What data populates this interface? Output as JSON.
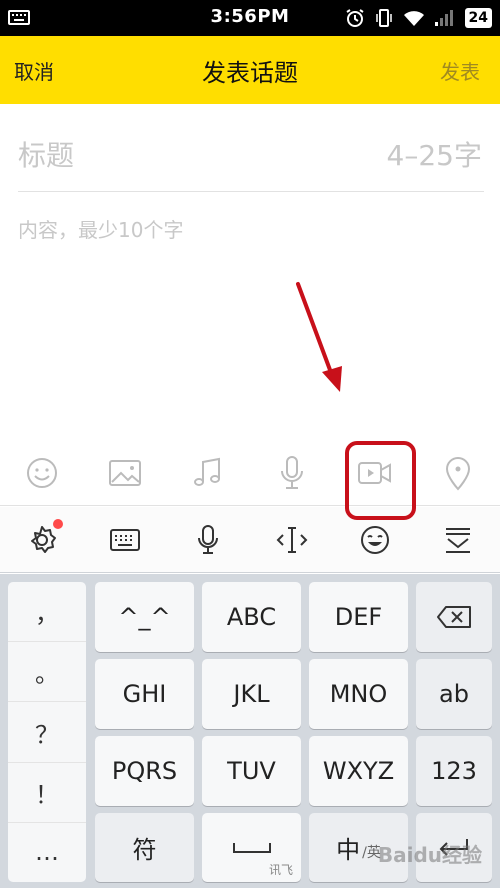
{
  "status_bar": {
    "time": "3:56PM",
    "battery": "24"
  },
  "header": {
    "cancel": "取消",
    "title": "发表话题",
    "publish": "发表"
  },
  "editor": {
    "title_placeholder": "标题",
    "title_hint": "4–25字",
    "content_placeholder": "内容，最少10个字"
  },
  "media_toolbar": [
    "emoji-icon",
    "image-icon",
    "music-icon",
    "microphone-icon",
    "video-icon",
    "location-icon"
  ],
  "ime_toolbar": [
    "settings-icon",
    "keyboard-icon",
    "voice-icon",
    "cursor-icon",
    "emoji-icon",
    "hide-keyboard-icon"
  ],
  "keyboard": {
    "punctuation": [
      "，",
      "。",
      "？",
      "！",
      "…"
    ],
    "rows": [
      [
        "^_^",
        "ABC",
        "DEF"
      ],
      [
        "GHI",
        "JKL",
        "MNO",
        "ab"
      ],
      [
        "PQRS",
        "TUV",
        "WXYZ",
        "123"
      ]
    ],
    "symbol_key": "符",
    "space_label": "讯飞",
    "lang_key_main": "中",
    "lang_key_sub": "/英"
  },
  "watermark": "Baidu经验",
  "colors": {
    "header_bg": "#ffde00",
    "annotation": "#c8101a"
  }
}
